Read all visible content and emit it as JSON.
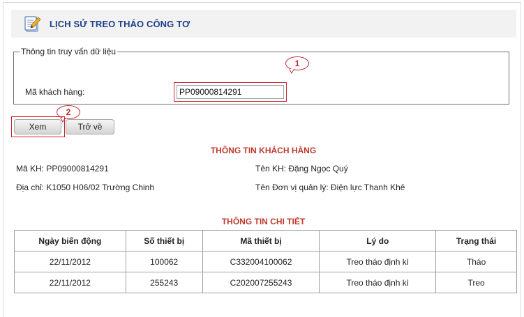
{
  "header": {
    "title": "LỊCH SỬ TREO THÁO CÔNG TƠ",
    "icon": "edit-form-icon"
  },
  "query": {
    "legend": "Thông tin truy vấn dữ liệu",
    "customer_code_label": "Mã khách hàng:",
    "customer_code_value": "PP09000814291"
  },
  "callouts": {
    "one": "1",
    "two": "2",
    "color": "#c8252c"
  },
  "buttons": {
    "view": "Xem",
    "back": "Trở về"
  },
  "customer_info": {
    "title": "THÔNG TIN KHÁCH HÀNG",
    "code": "Mã KH: PP09000814291",
    "name": "Tên KH: Đặng Ngọc Quý",
    "address": "Địa chỉ: K1050 H06/02 Trường Chinh",
    "unit": "Tên Đơn vị quản lý: Điện lực Thanh Khê"
  },
  "detail": {
    "title": "THÔNG TIN CHI TIẾT",
    "columns": [
      "Ngày biến động",
      "Số thiết bị",
      "Mã thiết bị",
      "Lý do",
      "Trạng thái"
    ],
    "rows": [
      [
        "22/11/2012",
        "100062",
        "C332004100062",
        "Treo tháo định kì",
        "Tháo"
      ],
      [
        "22/11/2012",
        "255243",
        "C202007255243",
        "Treo tháo định kì",
        "Treo"
      ]
    ]
  },
  "colors": {
    "title_blue": "#1f3e8a",
    "section_red": "#c0392b",
    "header_bg": "#f2f2f2"
  }
}
